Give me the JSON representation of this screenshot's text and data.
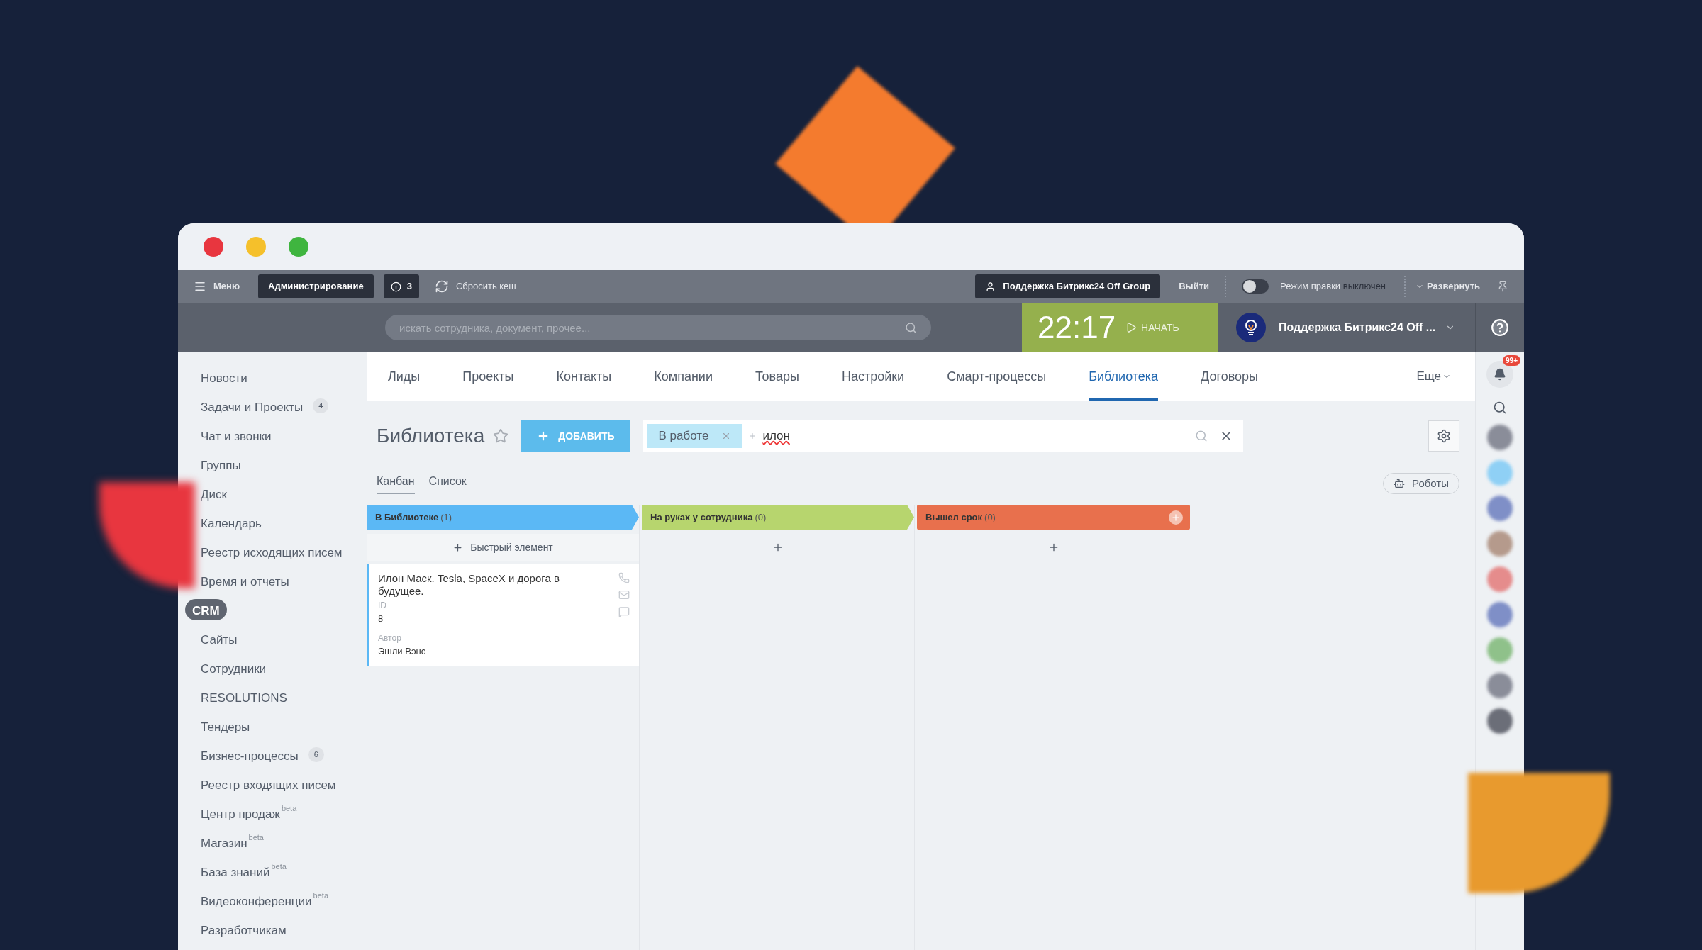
{
  "admin_bar": {
    "menu": "Меню",
    "admin": "Администрирование",
    "messages_count": "3",
    "reset_cache": "Сбросить кеш",
    "user": "Поддержка Битрикс24 Off Group",
    "logout": "Выйти",
    "edit_mode": {
      "label": "Режим правки",
      "status": "выключен",
      "on": false
    },
    "expand": "Развернуть"
  },
  "header": {
    "search_placeholder": "искать сотрудника, документ, прочее...",
    "timer": {
      "time": "22:17",
      "action": "НАЧАТЬ"
    },
    "account": "Поддержка Битрикс24 Off ..."
  },
  "sidebar": {
    "items": [
      {
        "label": "Новости",
        "selected": false
      },
      {
        "label": "Задачи и Проекты",
        "counter": "4",
        "selected": false
      },
      {
        "label": "Чат и звонки",
        "selected": false
      },
      {
        "label": "Группы",
        "selected": false
      },
      {
        "label": "Диск",
        "selected": false
      },
      {
        "label": "Календарь",
        "selected": false
      },
      {
        "label": "Реестр исходящих писем",
        "selected": false
      },
      {
        "label": "Время и отчеты",
        "selected": false
      },
      {
        "label": "CRM",
        "selected": true
      },
      {
        "label": "Сайты",
        "selected": false
      },
      {
        "label": "Сотрудники",
        "selected": false
      },
      {
        "label": "RESOLUTIONS",
        "selected": false
      },
      {
        "label": "Тендеры",
        "selected": false
      },
      {
        "label": "Бизнес-процессы",
        "counter": "6",
        "selected": false
      },
      {
        "label": "Реестр входящих писем",
        "selected": false
      },
      {
        "label": "Центр продаж",
        "badge": "beta",
        "selected": false
      },
      {
        "label": "Магазин",
        "badge": "beta",
        "selected": false
      },
      {
        "label": "База знаний",
        "badge": "beta",
        "selected": false
      },
      {
        "label": "Видеоконференции",
        "badge": "beta",
        "selected": false
      },
      {
        "label": "Разработчикам",
        "selected": false
      }
    ]
  },
  "tabs": [
    {
      "label": "Лиды",
      "selected": false
    },
    {
      "label": "Проекты",
      "selected": false
    },
    {
      "label": "Контакты",
      "selected": false
    },
    {
      "label": "Компании",
      "selected": false
    },
    {
      "label": "Товары",
      "selected": false
    },
    {
      "label": "Настройки",
      "selected": false
    },
    {
      "label": "Смарт-процессы",
      "selected": false
    },
    {
      "label": "Библиотека",
      "selected": true
    },
    {
      "label": "Договоры",
      "selected": false
    }
  ],
  "tabs_more": "Еще",
  "page": {
    "title": "Библиотека",
    "add_button": "ДОБАВИТЬ",
    "filter": {
      "chips": [
        "В работе"
      ],
      "query": "илон"
    },
    "views": [
      {
        "label": "Канбан",
        "selected": true
      },
      {
        "label": "Список",
        "selected": false
      }
    ],
    "robots": "Роботы"
  },
  "columns": [
    {
      "title": "В Библиотеке",
      "count": "(1)",
      "color": "#5bb8f5",
      "quick_add": "Быстрый элемент",
      "cards": [
        {
          "title": "Илон Маск. Tesla, SpaceX и дорога в будущее.",
          "fields": [
            {
              "label": "ID",
              "value": "8"
            },
            {
              "label": "Автор",
              "value": "Эшли Вэнс"
            }
          ]
        }
      ]
    },
    {
      "title": "На руках у сотрудника",
      "count": "(0)",
      "color": "#b7d56e"
    },
    {
      "title": "Вышел срок",
      "count": "(0)",
      "color": "#e8704d"
    }
  ],
  "notifications": {
    "count": "99+"
  }
}
